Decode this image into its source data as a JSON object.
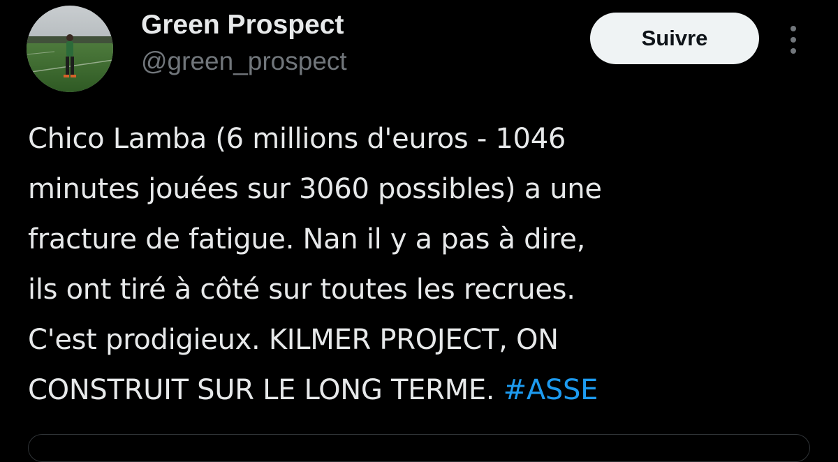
{
  "author": {
    "display_name": "Green Prospect",
    "handle": "@green_prospect"
  },
  "actions": {
    "follow_label": "Suivre",
    "more_icon": "more-vertical-icon"
  },
  "tweet": {
    "lines": [
      "Chico Lamba (6 millions d'euros - 1046",
      "minutes jouées sur 3060 possibles) a une",
      "fracture de fatigue. Nan il y a pas à dire,",
      "ils ont tiré à côté sur toutes les recrues.",
      "C'est prodigieux. KILMER PROJECT, ON",
      "CONSTRUIT SUR LE LONG TERME."
    ],
    "hashtag": "#ASSE"
  },
  "colors": {
    "background": "#000000",
    "primary_text": "#e7e9ea",
    "secondary_text": "#71767b",
    "link": "#1d9bf0",
    "follow_button_bg": "#eff3f4",
    "follow_button_text": "#0f1419",
    "border": "#2f3336"
  }
}
